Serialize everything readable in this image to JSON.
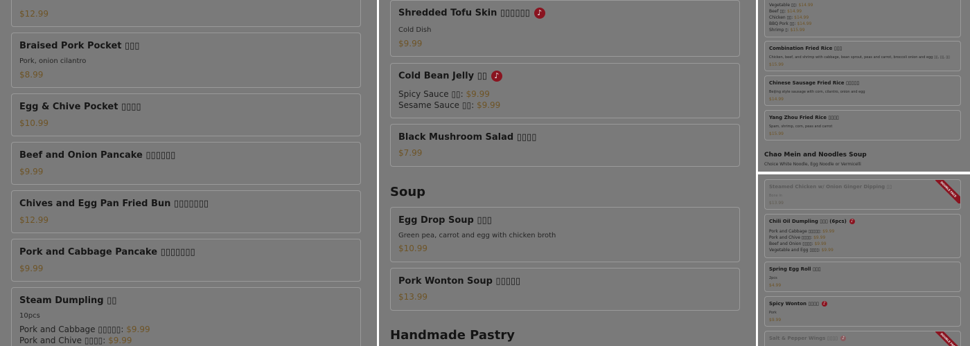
{
  "colors": {
    "overlay": "#7a7a7a",
    "price": "#6e5426",
    "spicy_badge": "#8a1420",
    "divider": "#ffffff"
  },
  "icons": {
    "spicy": "chili-pepper-icon"
  },
  "panel1": {
    "top_price": "$12.99",
    "items": [
      {
        "name": "Braised Pork Pocket ▯▯▯",
        "desc": "Pork, onion cilantro",
        "price": "$8.99"
      },
      {
        "name": "Egg & Chive Pocket ▯▯▯▯",
        "price": "$10.99"
      },
      {
        "name": "Beef and Onion Pancake ▯▯▯▯▯▯",
        "price": "$9.99"
      },
      {
        "name": "Chives and Egg Pan Fried Bun ▯▯▯▯▯▯▯",
        "price": "$12.99"
      },
      {
        "name": "Pork and Cabbage Pancake ▯▯▯▯▯▯▯",
        "price": "$9.99"
      },
      {
        "name": "Steam Dumpling ▯▯",
        "desc": "10pcs",
        "options": [
          {
            "label": "Pork and Cabbage ▯▯▯▯▯:",
            "price": "$9.99"
          },
          {
            "label": "Pork and Chive ▯▯▯▯:",
            "price": "$9.99"
          }
        ]
      }
    ]
  },
  "panel2": {
    "items_top": [
      {
        "name": "Shredded Tofu Skin ▯▯▯▯▯▯",
        "desc": "Cold Dish",
        "price": "$9.99"
      },
      {
        "name": "Cold Bean Jelly ▯▯",
        "options": [
          {
            "label": "Spicy Sauce ▯▯:",
            "price": "$9.99"
          },
          {
            "label": "Sesame Sauce ▯▯:",
            "price": "$9.99"
          }
        ]
      },
      {
        "name": "Black Mushroom Salad ▯▯▯▯",
        "price": "$7.99"
      }
    ],
    "section_soup": "Soup",
    "soup_items": [
      {
        "name": "Egg Drop Soup ▯▯▯",
        "desc": "Green pea, carrot and egg with chicken broth",
        "price": "$10.99"
      },
      {
        "name": "Pork Wonton Soup ▯▯▯▯▯",
        "price": "$13.99"
      }
    ],
    "section_pastry": "Handmade Pastry"
  },
  "panel3": {
    "top_options": [
      {
        "label": "Vegetable ▯▯:",
        "price": "$14.99"
      },
      {
        "label": "Beef ▯▯:",
        "price": "$14.99"
      },
      {
        "label": "Chicken ▯▯:",
        "price": "$14.99"
      },
      {
        "label": "BBQ Pork ▯▯:",
        "price": "$14.99"
      },
      {
        "label": "Shrimp ▯:",
        "price": "$15.99"
      }
    ],
    "items": [
      {
        "name": "Combination Fried Rice ▯▯▯",
        "desc": "Chicken, beef, and shrimp with cabbage, bean sprout, peas and carrot, broccoli onion and egg ▯▯, ▯▯, ▯▯",
        "price": "$15.99"
      },
      {
        "name": "Chinese Sausage Fried Rice ▯▯▯▯▯",
        "desc": "Beijing style sausage with corn, cilantro, onion and egg",
        "price": "$14.99"
      },
      {
        "name": "Yang Zhou Fried Rice ▯▯▯▯",
        "desc": "Spam, shrimp, corn, peas and carrot",
        "price": "$15.99"
      }
    ],
    "section": "Chao Mein and Noodles Soup",
    "section_note": "Choice White Noodle, Egg Noodle or Vermicelli"
  },
  "panel4": {
    "items": [
      {
        "name": "Steamed Chicken w/ Onion Ginger Dipping ▯▯",
        "desc": "Bone In",
        "price": "$13.99",
        "ribbon": "DOUBLE FACE"
      },
      {
        "name": "Chili Oil Dumpling ▯▯▯ (6pcs)",
        "options": [
          {
            "label": "Pork and Cabbage ▯▯▯▯▯:",
            "price": "$9.99"
          },
          {
            "label": "Pork and Chive ▯▯▯▯:",
            "price": "$9.99"
          },
          {
            "label": "Beef and Onion ▯▯▯▯:",
            "price": "$9.99"
          },
          {
            "label": "Vegetable and Egg ▯▯▯▯:",
            "price": "$9.99"
          }
        ]
      },
      {
        "name": "Spring Egg Roll ▯▯▯",
        "desc": "2pcs",
        "price": "$4.99"
      },
      {
        "name": "Spicy Wonton ▯▯▯▯",
        "desc": "Pork",
        "price": "$9.99"
      },
      {
        "name": "Salt & Pepper Wings ▯▯▯▯",
        "ribbon": "DOUBLE FACE"
      }
    ]
  }
}
